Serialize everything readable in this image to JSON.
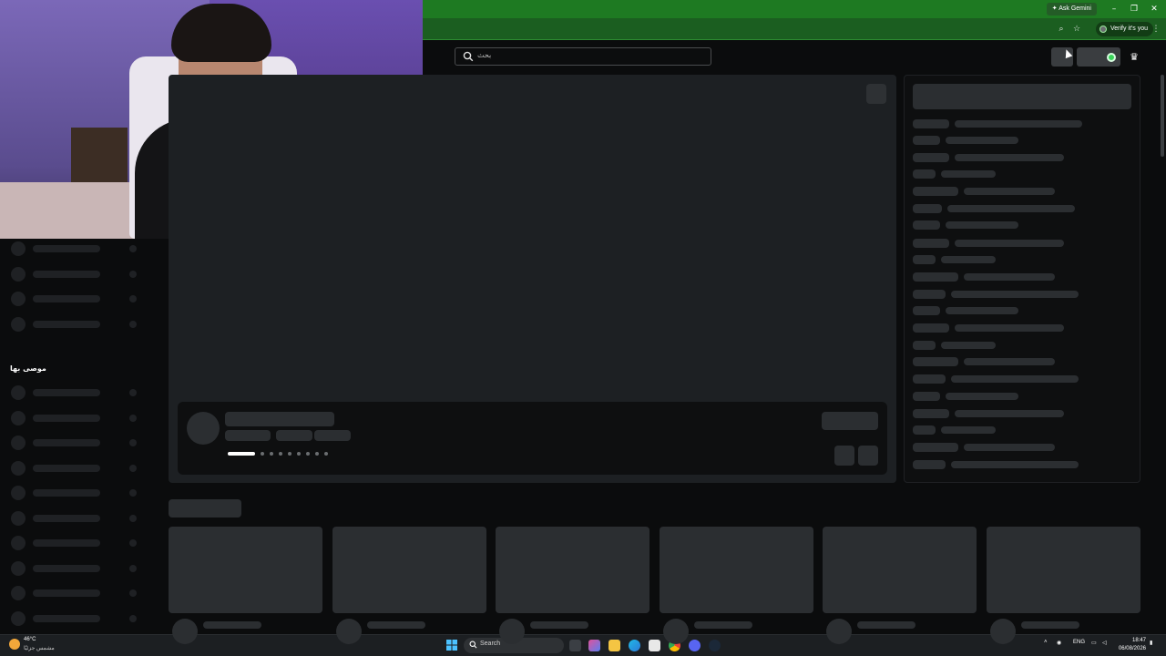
{
  "browser": {
    "ask_gemini": "Ask Gemini",
    "verify_label": "Verify it's you",
    "zoom_icon": "zoom-icon",
    "star_icon": "star-icon",
    "menu_icon": "kebab-menu-icon"
  },
  "site": {
    "search_placeholder": "بحث",
    "sidebar_section_label": "موصى بها"
  },
  "taskbar": {
    "temperature": "46°C",
    "weather_condition": "مشمس جزئيًا",
    "search_placeholder": "Search",
    "language": "ENG",
    "time": "18:47",
    "date": "06/08/2026"
  },
  "colors": {
    "titlebar": "#1e7a22",
    "toolbar": "#1b5e20",
    "accent_green": "#3ad45a",
    "skeleton": "#2b2e31",
    "background": "#0b0c0d"
  }
}
